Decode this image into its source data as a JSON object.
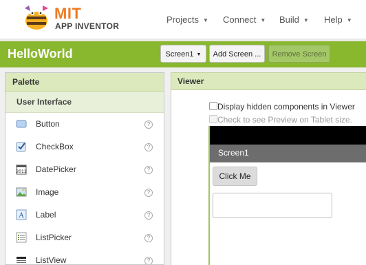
{
  "brand": {
    "name": "MIT",
    "subtitle": "APP INVENTOR"
  },
  "top_menu": [
    {
      "label": "Projects"
    },
    {
      "label": "Connect"
    },
    {
      "label": "Build"
    },
    {
      "label": "Help"
    }
  ],
  "project": {
    "title": "HelloWorld",
    "screen_select": "Screen1",
    "add_screen_label": "Add Screen ...",
    "remove_screen_label": "Remove Screen"
  },
  "palette": {
    "title": "Palette",
    "category": "User Interface",
    "items": [
      {
        "label": "Button",
        "icon": "button-icon"
      },
      {
        "label": "CheckBox",
        "icon": "checkbox-icon"
      },
      {
        "label": "DatePicker",
        "icon": "datepicker-icon"
      },
      {
        "label": "Image",
        "icon": "image-icon"
      },
      {
        "label": "Label",
        "icon": "label-icon"
      },
      {
        "label": "ListPicker",
        "icon": "listpicker-icon"
      },
      {
        "label": "ListView",
        "icon": "listview-icon"
      }
    ],
    "help_glyph": "?"
  },
  "viewer": {
    "title": "Viewer",
    "display_hidden_label": "Display hidden components in Viewer",
    "tablet_preview_label": "Check to see Preview on Tablet size.",
    "screen_title": "Screen1",
    "button_text": "Click Me",
    "textbox_value": ""
  },
  "colors": {
    "accent_green": "#89b72e",
    "panel_header": "#dbe9bd",
    "brand_orange": "#ee7a22"
  }
}
